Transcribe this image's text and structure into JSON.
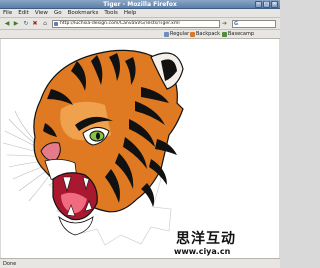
{
  "window": {
    "title": "Tiger - Mozilla Firefox",
    "buttons": {
      "minimize": "–",
      "maximize": "□",
      "close": "×"
    }
  },
  "menu": {
    "items": [
      "File",
      "Edit",
      "View",
      "Go",
      "Bookmarks",
      "Tools",
      "Help"
    ]
  },
  "navigation": {
    "back_icon": "back-arrow-icon",
    "forward_icon": "forward-arrow-icon",
    "reload_icon": "reload-icon",
    "stop_icon": "stop-icon",
    "home_icon": "home-icon",
    "url": "http://luchsia-design.com/CanvaSVG/Tests/Tiger.xml",
    "search_engine_glyph": "G"
  },
  "bookmarks": {
    "items": [
      "Regular",
      "Backpack",
      "Basecamp"
    ]
  },
  "watermark": {
    "chinese": "思洋互动",
    "url": "www.ciya.cn"
  },
  "status": {
    "text": "Done"
  },
  "colors": {
    "titlebar": "#6f8fb8",
    "chrome": "#e8e6e2",
    "tiger_orange": "#e07a22",
    "tiger_black": "#111111",
    "eye_green": "#86c544",
    "mouth_pink": "#f06a80"
  }
}
